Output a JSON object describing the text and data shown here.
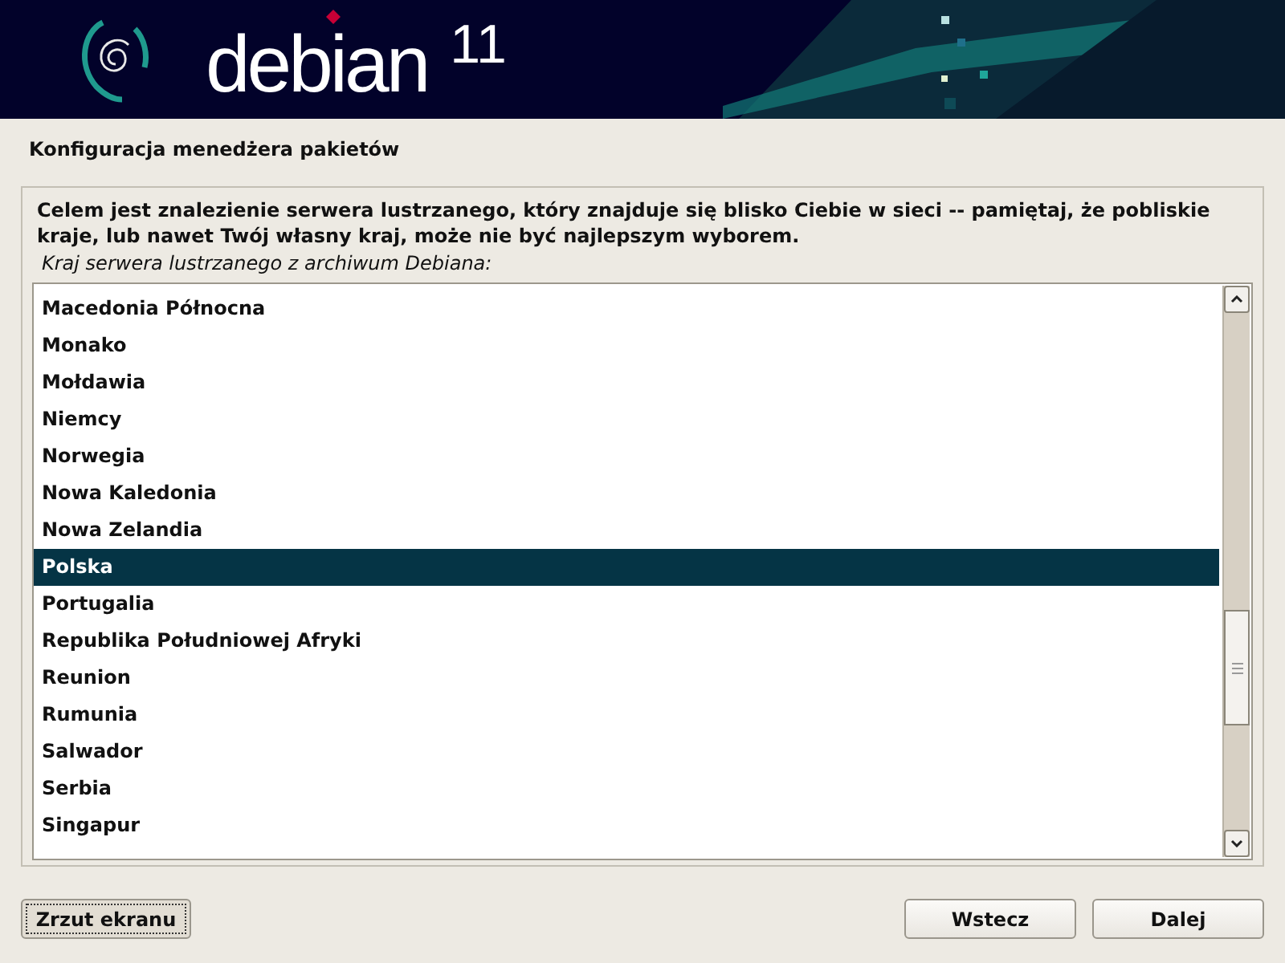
{
  "banner": {
    "brand": "debian",
    "version": "11"
  },
  "title": "Konfiguracja menedżera pakietów",
  "description": "Celem jest znalezienie serwera lustrzanego, który znajduje się blisko Ciebie w sieci -- pamiętaj, że pobliskie kraje, lub nawet Twój własny kraj, może nie być najlepszym wyborem.",
  "list_label": "Kraj serwera lustrzanego z archiwum Debiana:",
  "countries": [
    {
      "label": "Macedonia Północna",
      "selected": false
    },
    {
      "label": "Monako",
      "selected": false
    },
    {
      "label": "Mołdawia",
      "selected": false
    },
    {
      "label": "Niemcy",
      "selected": false
    },
    {
      "label": "Norwegia",
      "selected": false
    },
    {
      "label": "Nowa Kaledonia",
      "selected": false
    },
    {
      "label": "Nowa Zelandia",
      "selected": false
    },
    {
      "label": "Polska",
      "selected": true
    },
    {
      "label": "Portugalia",
      "selected": false
    },
    {
      "label": "Republika Południowej Afryki",
      "selected": false
    },
    {
      "label": "Reunion",
      "selected": false
    },
    {
      "label": "Rumunia",
      "selected": false
    },
    {
      "label": "Salwador",
      "selected": false
    },
    {
      "label": "Serbia",
      "selected": false
    },
    {
      "label": "Singapur",
      "selected": false
    }
  ],
  "buttons": {
    "screenshot": "Zrzut ekranu",
    "back": "Wstecz",
    "next": "Dalej"
  }
}
